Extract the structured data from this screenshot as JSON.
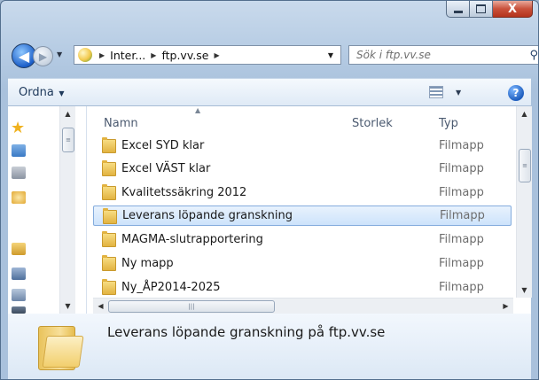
{
  "window": {
    "controls": {
      "minimize_icon": "minimize-icon",
      "maximize_icon": "maximize-icon",
      "close_icon": "close-icon",
      "close_label": "X"
    }
  },
  "nav": {
    "back_icon": "back-arrow-icon",
    "forward_icon": "forward-arrow-icon",
    "breadcrumb": [
      "Inter...",
      "ftp.vv.se"
    ],
    "search_placeholder": "Sök i ftp.vv.se"
  },
  "toolbar": {
    "organize_label": "Ordna",
    "help_label": "?"
  },
  "list": {
    "columns": [
      "Namn",
      "Storlek",
      "Typ"
    ],
    "rows": [
      {
        "name": "Excel SYD klar",
        "size": "",
        "type": "Filmapp",
        "selected": false
      },
      {
        "name": "Excel VÄST klar",
        "size": "",
        "type": "Filmapp",
        "selected": false
      },
      {
        "name": "Kvalitetssäkring 2012",
        "size": "",
        "type": "Filmapp",
        "selected": false
      },
      {
        "name": "Leverans löpande granskning",
        "size": "",
        "type": "Filmapp",
        "selected": true
      },
      {
        "name": "MAGMA-slutrapportering",
        "size": "",
        "type": "Filmapp",
        "selected": false
      },
      {
        "name": "Ny mapp",
        "size": "",
        "type": "Filmapp",
        "selected": false
      },
      {
        "name": "Ny_ÅP2014-2025",
        "size": "",
        "type": "Filmapp",
        "selected": false
      }
    ]
  },
  "details": {
    "text": "Leverans löpande granskning på ftp.vv.se"
  },
  "colors": {
    "selection": "#cde3fb",
    "frame": "#b5cbe3",
    "close_button": "#c9513b"
  }
}
